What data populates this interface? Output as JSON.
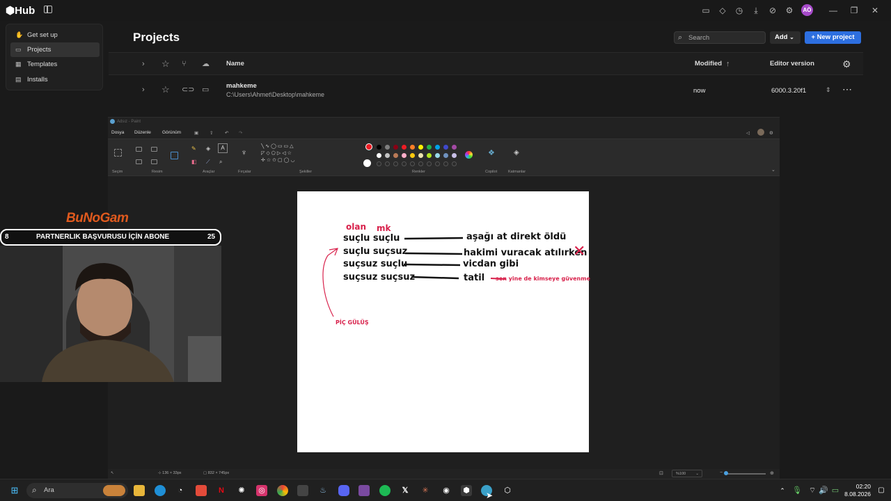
{
  "hub": {
    "logo": "Hub",
    "avatar_initials": "AÖ",
    "sidebar": [
      {
        "label": "Get set up",
        "icon": "wave-hand-icon"
      },
      {
        "label": "Projects",
        "icon": "folder-icon",
        "active": true
      },
      {
        "label": "Templates",
        "icon": "grid-icon"
      },
      {
        "label": "Installs",
        "icon": "installs-icon"
      }
    ],
    "page_title": "Projects",
    "search_placeholder": "Search",
    "add_label": "Add",
    "new_project_label": "+ New project",
    "columns": {
      "name": "Name",
      "modified": "Modified",
      "editor_version": "Editor version"
    },
    "project": {
      "name": "mahkeme",
      "path": "C:\\Users\\Ahmet\\Desktop\\mahkeme",
      "modified": "now",
      "editor_version": "6000.3.20f1"
    }
  },
  "paint": {
    "title": "Adsız - Paint",
    "menu": [
      "Dosya",
      "Düzenle",
      "Görünüm"
    ],
    "ribbon_groups": [
      "Seçim",
      "Resim",
      "Araçlar",
      "Fırçalar",
      "Şekiller",
      "Renkler",
      "Copilot",
      "Katmanlar"
    ],
    "colors": {
      "palette_top": [
        "#000000",
        "#7f7f7f",
        "#880015",
        "#ed1c24",
        "#ff7f27",
        "#fff200",
        "#22b14c",
        "#00a2e8",
        "#3f48cc",
        "#a349a4"
      ],
      "palette_mid": [
        "#ffffff",
        "#c3c3c3",
        "#b97a57",
        "#ffaec9",
        "#ffc90e",
        "#efe4b0",
        "#b5e61d",
        "#99d9ea",
        "#7092be",
        "#c8bfe7"
      ],
      "primary": "#ed1c24",
      "secondary": "#ffffff"
    },
    "canvas": {
      "heading_left": "olan",
      "heading_right": "mk",
      "rows": [
        {
          "left": "suçlu suçlu",
          "right": "aşağı at direkt öldü"
        },
        {
          "left": "suçlu suçsuz",
          "right": "hakimi vuracak atılırken"
        },
        {
          "left": "suçsuz suçlu",
          "right": "vicdan gibi"
        },
        {
          "left": "suçsuz suçsuz",
          "right": "tatil"
        }
      ],
      "side_note": "sen yine de kimseye güvenme",
      "bottom_note": "PİÇ GÜLÜŞ",
      "cross_mark": "✕"
    },
    "status": {
      "cursor_pos": "136 × 33px",
      "canvas_size": "832 × 745px",
      "zoom": "%100"
    }
  },
  "overlay": {
    "logo_text": "BuNoGam",
    "banner": {
      "left_num": "8",
      "text": "PARTNERLIK BAŞVURUSU İÇİN ABONE",
      "right_num": "25"
    }
  },
  "taskbar": {
    "search_placeholder": "Ara",
    "time": "02:20",
    "date": "8.08.2026",
    "apps": [
      "file-explorer-icon",
      "edge-icon",
      "speedometer-icon",
      "anydesk-icon",
      "netflix-icon",
      "chatgpt-icon",
      "instagram-icon",
      "chrome-icon",
      "epic-icon",
      "steam-icon",
      "discord-icon",
      "winrar-icon",
      "spotify-icon",
      "x-icon",
      "claude-icon",
      "github-icon",
      "unity-icon",
      "paint-icon",
      "unity-hub-icon"
    ]
  }
}
